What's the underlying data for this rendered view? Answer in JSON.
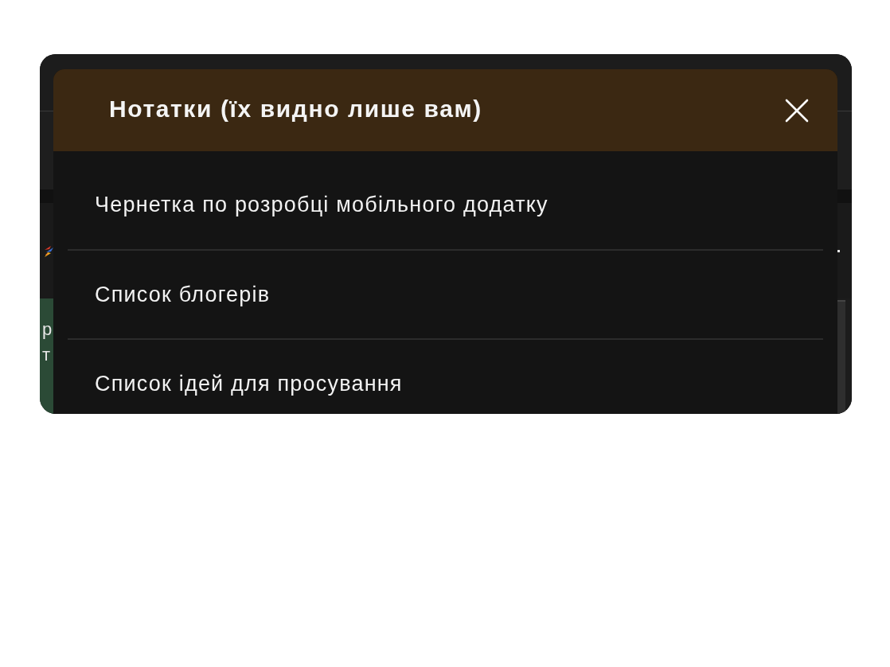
{
  "background": {
    "side_panel_lines": [
      "р",
      "т"
    ]
  },
  "dialog": {
    "title": "Нотатки (їх видно лише вам)",
    "notes": [
      "Чернетка по розробці мобільного додатку",
      "Список блогерів",
      "Список ідей для просування"
    ]
  }
}
